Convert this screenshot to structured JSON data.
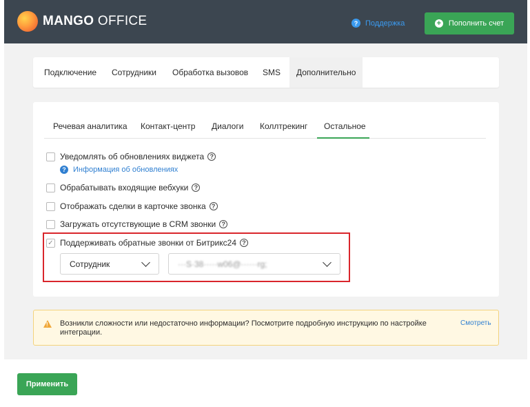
{
  "header": {
    "logo_bold": "MANGO",
    "logo_thin": "OFFICE",
    "support_label": "Поддержка",
    "topup_label": "Пополнить счет"
  },
  "main_tabs": [
    {
      "label": "Подключение",
      "active": false
    },
    {
      "label": "Сотрудники",
      "active": false
    },
    {
      "label": "Обработка вызовов",
      "active": false
    },
    {
      "label": "SMS",
      "active": false
    },
    {
      "label": "Дополнительно",
      "active": true
    }
  ],
  "sub_tabs": [
    {
      "label": "Речевая аналитика",
      "active": false
    },
    {
      "label": "Контакт-центр",
      "active": false
    },
    {
      "label": "Диалоги",
      "active": false
    },
    {
      "label": "Коллтрекинг",
      "active": false
    },
    {
      "label": "Остальное",
      "active": true
    }
  ],
  "options": [
    {
      "label": "Уведомлять об обновлениях виджета",
      "checked": false
    },
    {
      "label": "Обрабатывать входящие вебхуки",
      "checked": false
    },
    {
      "label": "Отображать сделки в карточке звонка",
      "checked": false
    },
    {
      "label": "Загружать отсутствующие в CRM звонки",
      "checked": false
    },
    {
      "label": "Поддерживать обратные звонки от Битрикс24",
      "checked": true
    }
  ],
  "info_link": "Информация об обновлениях",
  "selects": {
    "role_value": "Сотрудник",
    "employee_value": "···S·38·····w06@······rg;"
  },
  "warning": {
    "text": "Возникли сложности или недостаточно информации? Посмотрите подробную инструкцию по настройке интеграции.",
    "link": "Смотреть"
  },
  "footer": {
    "apply_label": "Применить"
  },
  "colors": {
    "header_bg": "#3c4650",
    "accent_green": "#3aa556",
    "link_blue": "#2f7fd1",
    "highlight_red": "#d9252b"
  }
}
